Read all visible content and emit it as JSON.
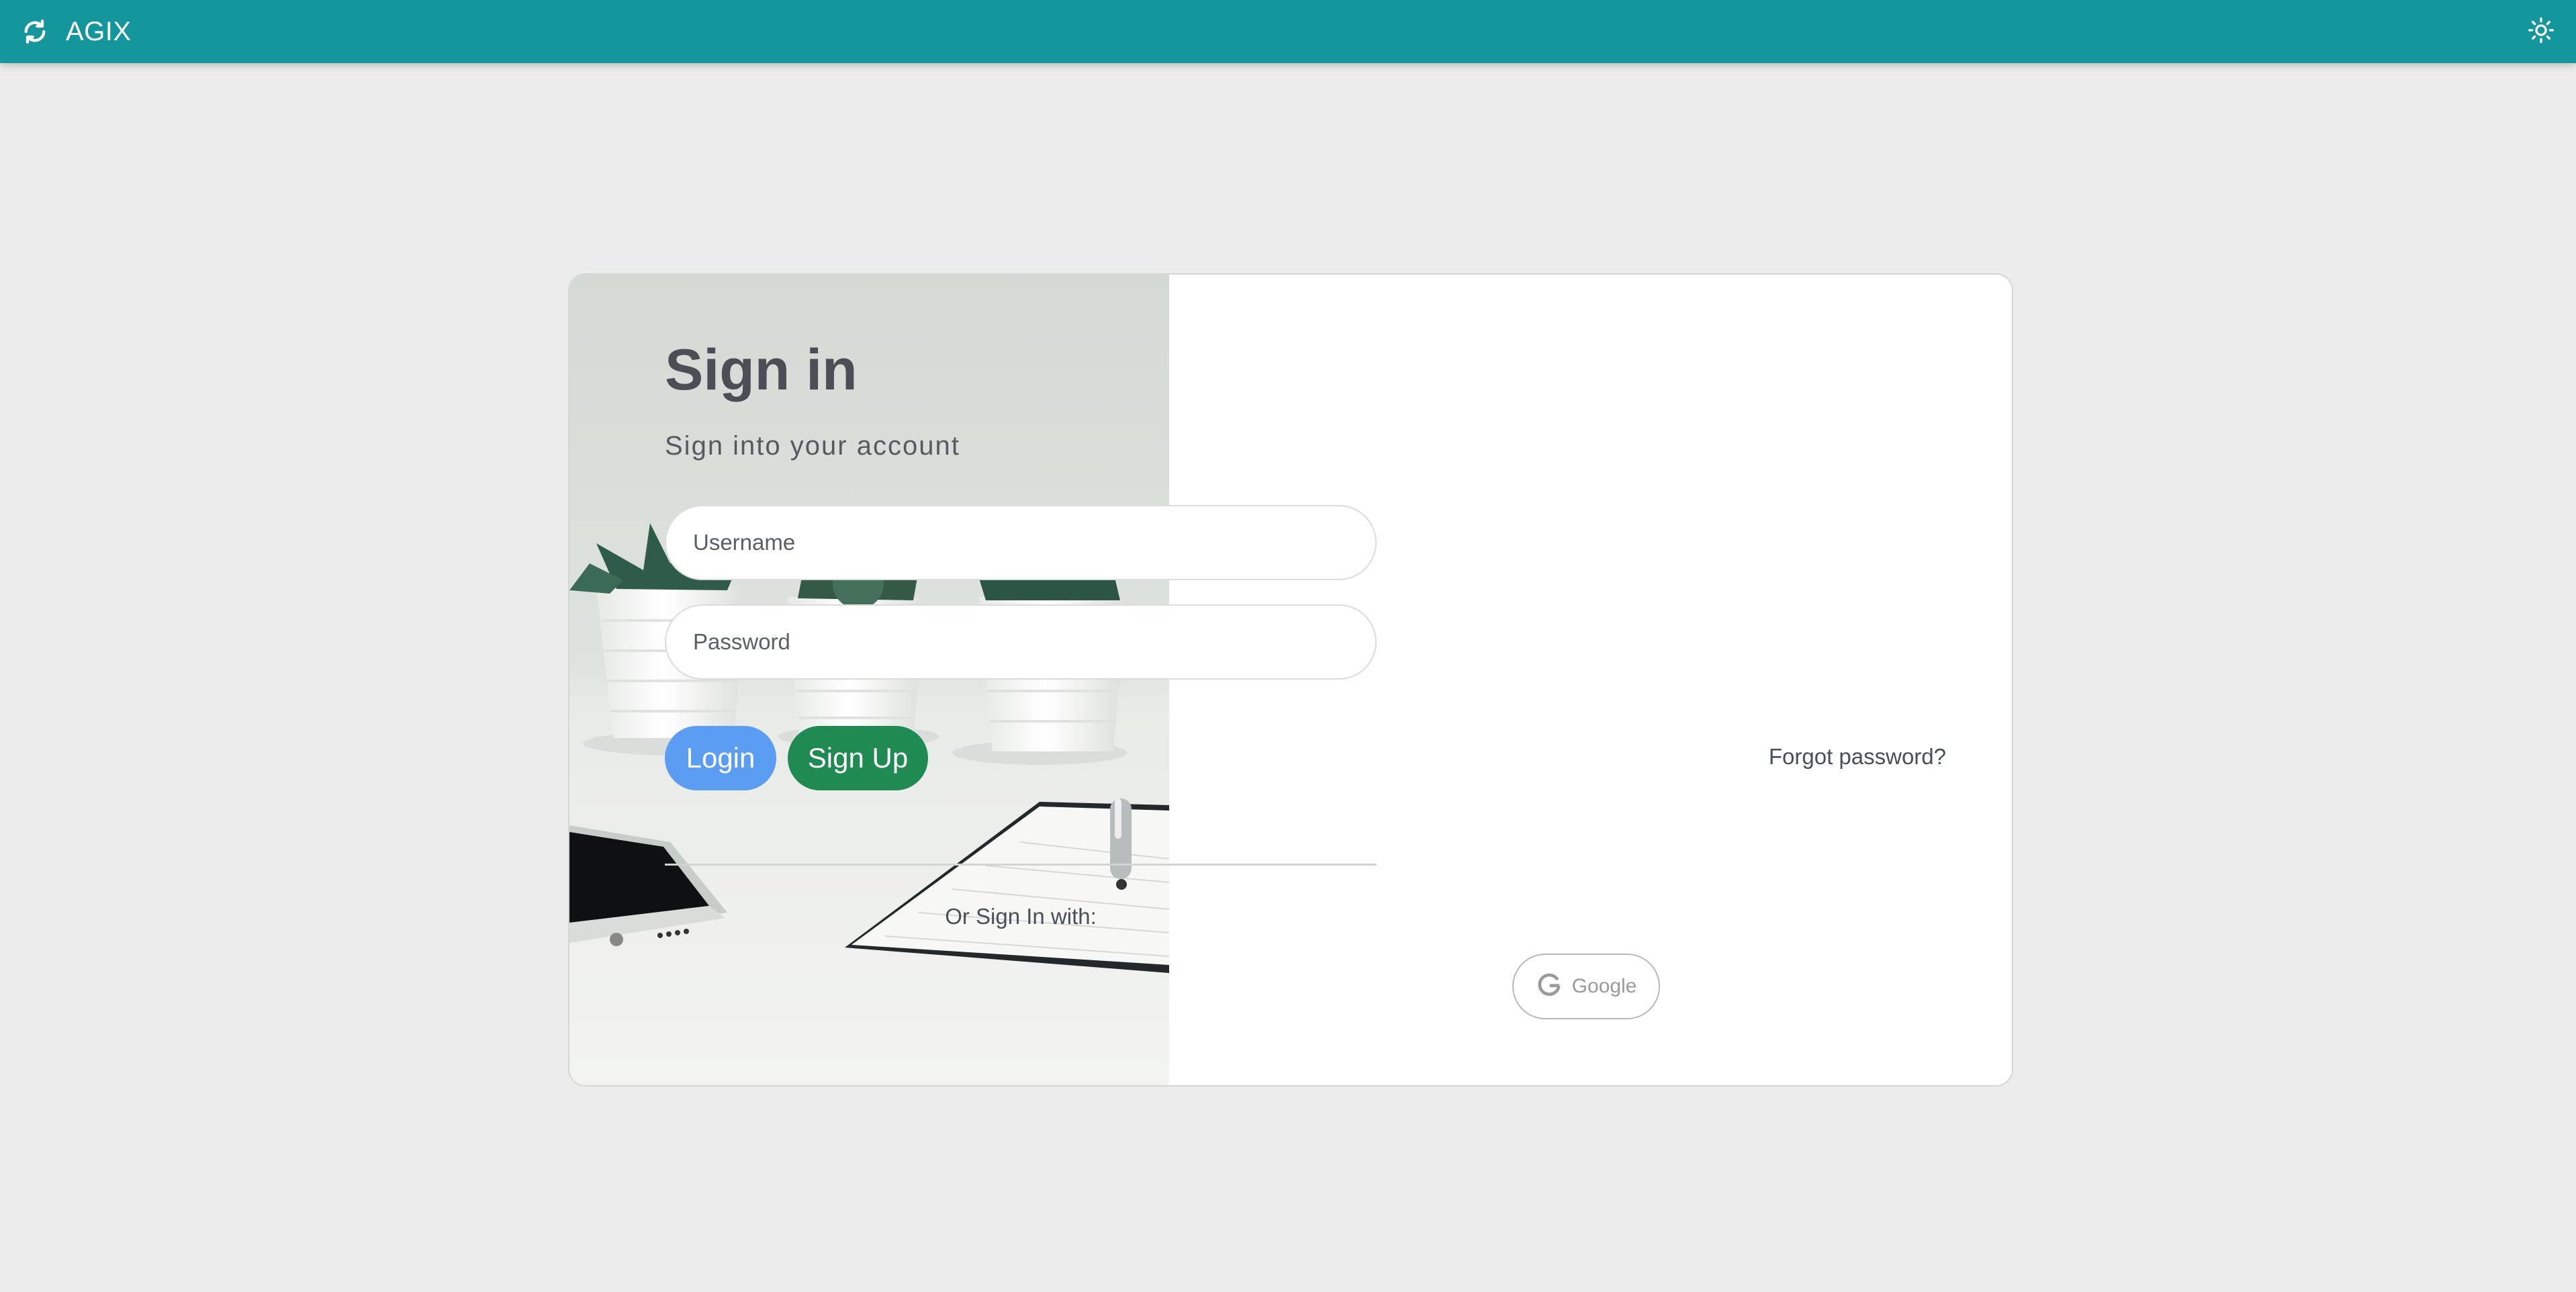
{
  "app": {
    "name": "AGIX",
    "logo_icon": "refresh-icon",
    "theme_toggle_icon": "sun-icon"
  },
  "colors": {
    "navbar": "#13979c",
    "background": "#ececec",
    "login_button": "#5a9df2",
    "signup_button": "#1f8a52",
    "heading_text": "#4a4f55"
  },
  "signin": {
    "title": "Sign in",
    "subtitle": "Sign into your account",
    "username_placeholder": "Username",
    "password_placeholder": "Password",
    "login_label": "Login",
    "signup_label": "Sign Up",
    "forgot_label": "Forgot password?",
    "or_text": "Or Sign In with:",
    "google_label": "Google",
    "google_icon": "google-icon"
  }
}
